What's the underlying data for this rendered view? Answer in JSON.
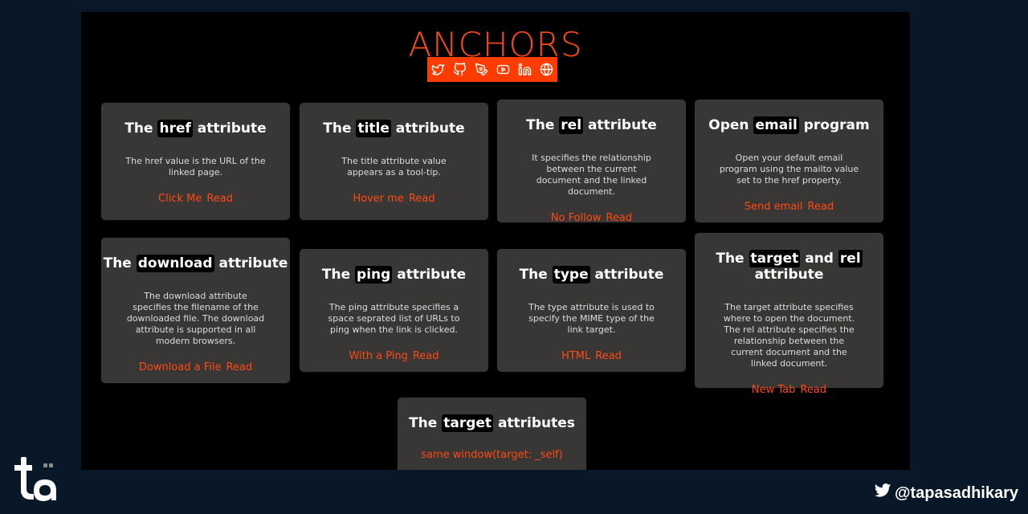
{
  "title": "ANCHORS",
  "social_icons": [
    "twitter-icon",
    "github-icon",
    "pen-icon",
    "youtube-icon",
    "linkedin-icon",
    "globe-icon"
  ],
  "colors": {
    "accent": "#ff4a12",
    "card_bg": "#393636",
    "page_bg": "#081828"
  },
  "cards": [
    {
      "title_pre": "The ",
      "title_hl": "href",
      "title_post": " attribute",
      "desc": "The href value is the URL of the linked page.",
      "link": "Click Me",
      "read": "Read"
    },
    {
      "title_pre": "The ",
      "title_hl": "title",
      "title_post": " attribute",
      "desc": "The title attribute value appears as a tool-tip.",
      "link": "Hover me",
      "read": "Read"
    },
    {
      "title_pre": "The ",
      "title_hl": "rel",
      "title_post": " attribute",
      "desc": "It specifies the relationship between the current document and the linked document.",
      "link": "No Follow",
      "read": "Read"
    },
    {
      "title_pre": "Open ",
      "title_hl": "email",
      "title_post": " program",
      "desc": "Open your default email program using the mailto value set to the href property.",
      "link": "Send email",
      "read": "Read"
    },
    {
      "title_pre": "The ",
      "title_hl": "download",
      "title_post": " attribute",
      "desc": "The download attribute specifies the filename of the downloaded file. The download attribute is supported in all modern browsers.",
      "link": "Download a File",
      "read": "Read"
    },
    {
      "title_pre": "The ",
      "title_hl": "ping",
      "title_post": " attribute",
      "desc": "The ping attribute specifies a space seprated list of URLs to ping when the link is clicked.",
      "link": "With a Ping",
      "read": "Read"
    },
    {
      "title_pre": "The ",
      "title_hl": "type",
      "title_post": " attribute",
      "desc": "The type attribute is used to specify the MIME type of the link target.",
      "link": "HTML",
      "read": "Read"
    },
    {
      "title_pre": "The ",
      "title_hl": "target",
      "title_mid": " and ",
      "title_hl2": "rel",
      "title_post": " attribute",
      "desc": "The target attribute specifies where to open the document. The rel attribute specifies the relationship between the current document and the linked document.",
      "link": "New Tab",
      "read": "Read"
    },
    {
      "title_pre": "The ",
      "title_hl": "target",
      "title_post": " attributes",
      "link": "same window(target: _self)"
    }
  ],
  "footer": {
    "handle": "@tapasadhikary"
  }
}
